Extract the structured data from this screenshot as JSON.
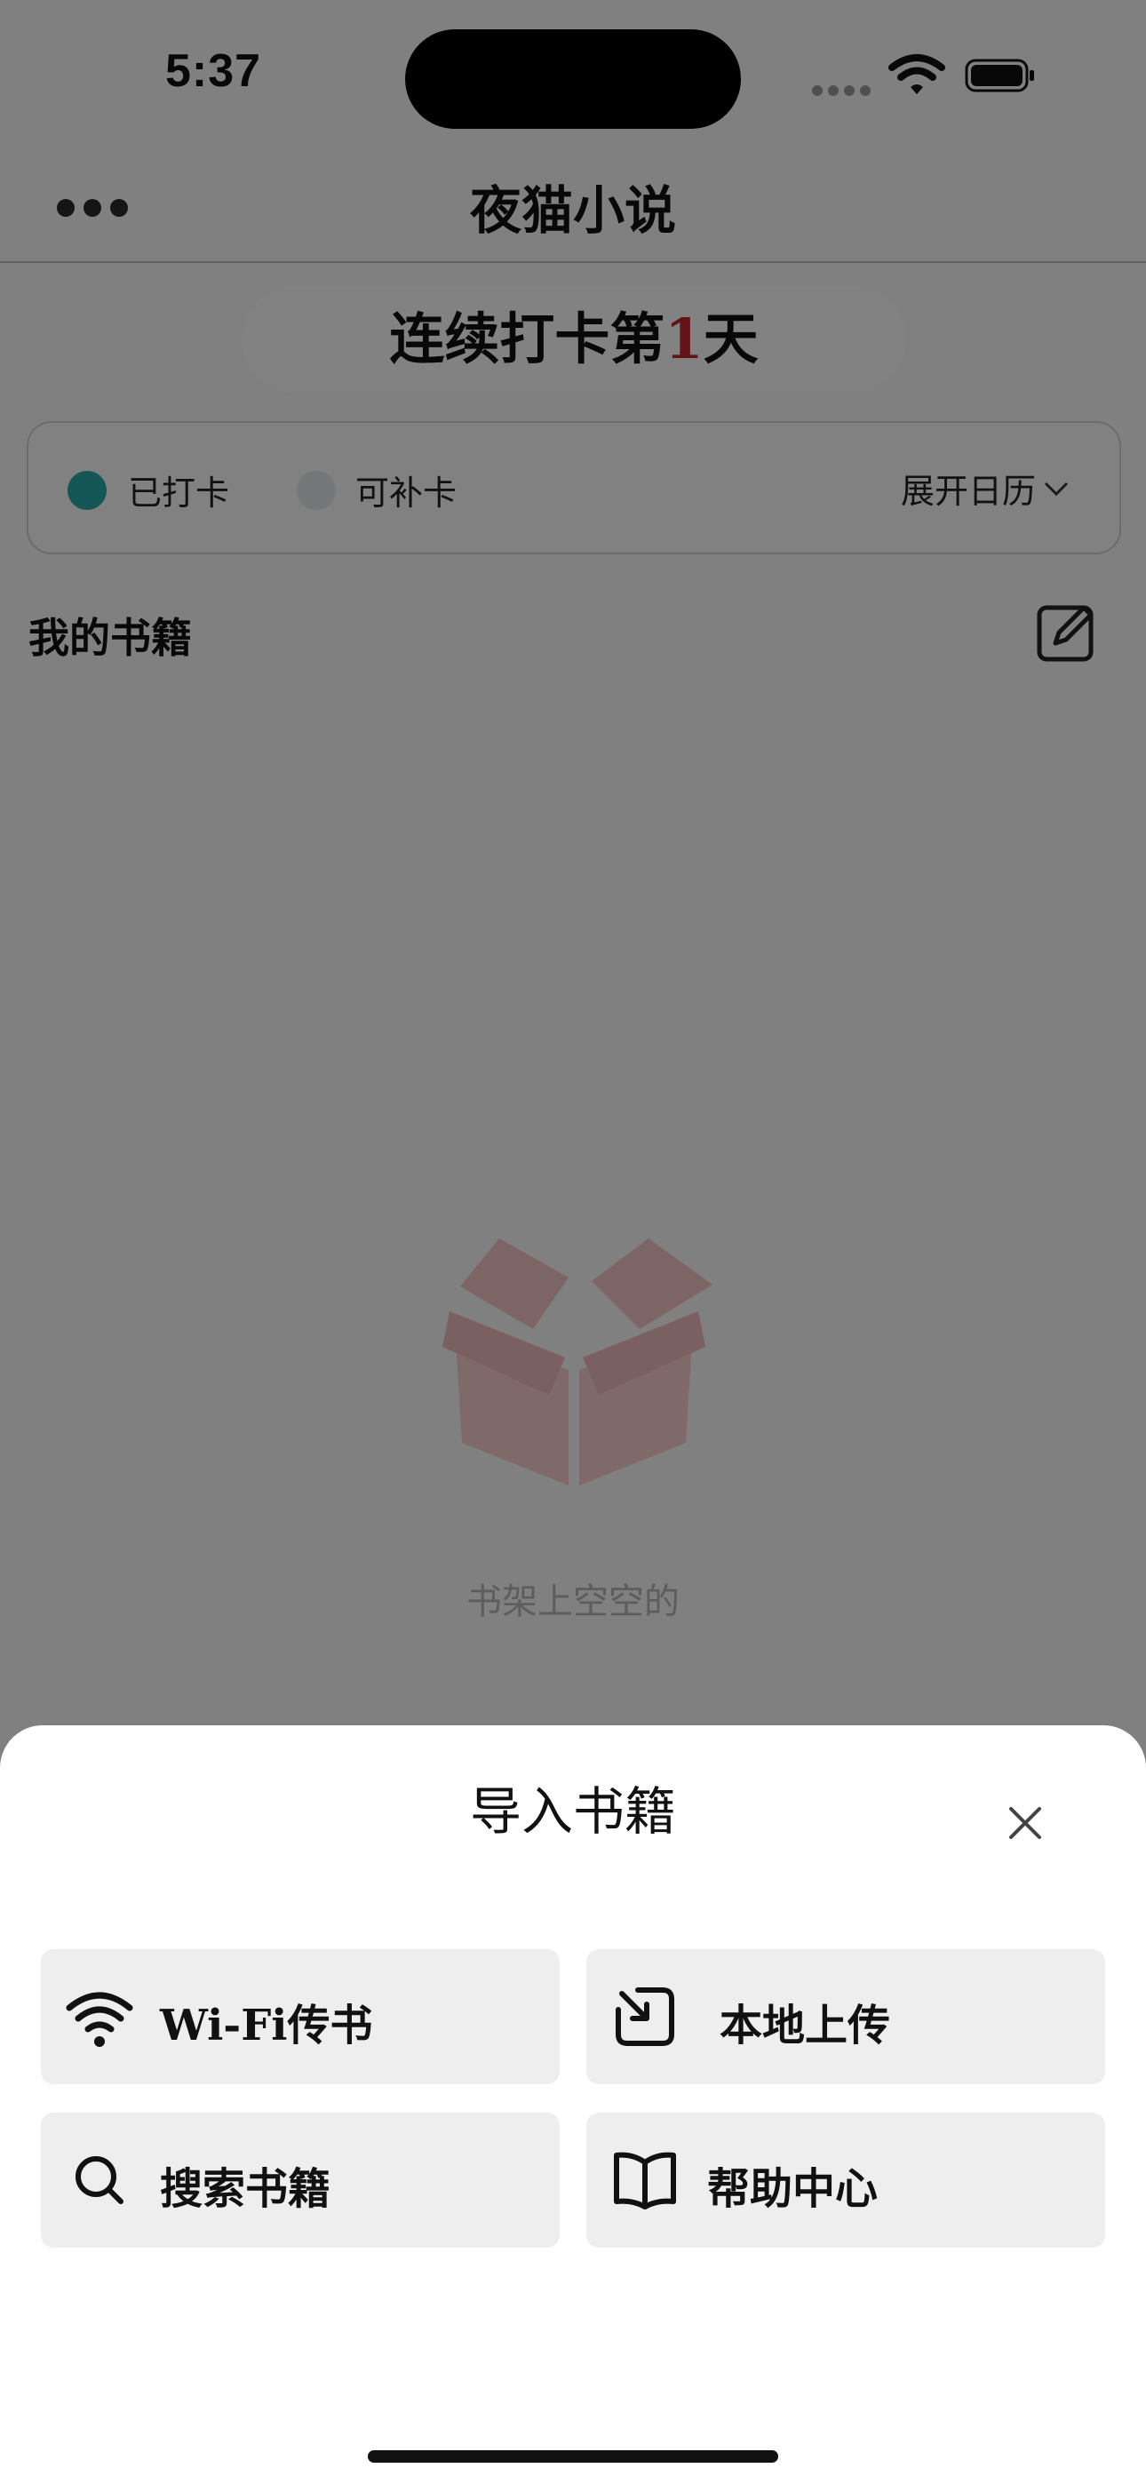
{
  "status_bar": {
    "time": "5:37"
  },
  "nav": {
    "title": "夜猫小说"
  },
  "streak": {
    "prefix": "连续打卡第",
    "count": "1",
    "suffix": "天"
  },
  "checkin": {
    "checked_label": "已打卡",
    "makeup_label": "可补卡",
    "expand_label": "展开日历",
    "checked_color": "#2aa6a6",
    "makeup_color": "#dfe7e7"
  },
  "books": {
    "title": "我的书籍",
    "empty_text": "书架上空空的"
  },
  "sheet": {
    "title": "导入书籍",
    "options": [
      {
        "label": "Wi-Fi传书",
        "icon": "wifi-icon"
      },
      {
        "label": "本地上传",
        "icon": "import-icon"
      },
      {
        "label": "搜索书籍",
        "icon": "search-icon"
      },
      {
        "label": "帮助中心",
        "icon": "book-icon"
      }
    ]
  },
  "colors": {
    "accent": "#c0262b",
    "overlay": "rgba(0,0,0,0.48)"
  }
}
